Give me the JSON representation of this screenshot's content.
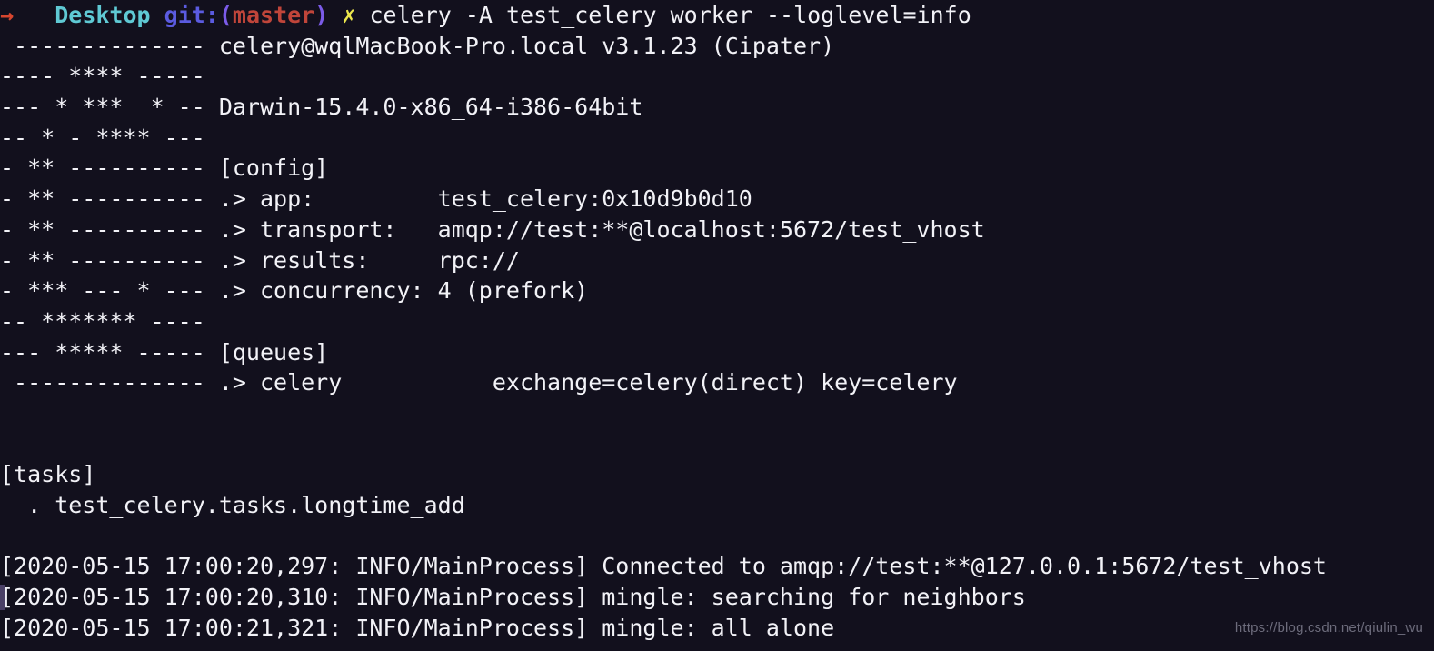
{
  "terminal": {
    "background_color": "#12101d",
    "foreground_color": "#f2f2f7",
    "prompt": {
      "arrow": "→",
      "arrow_color": "#d7462f",
      "directory": "Desktop",
      "directory_color": "#5fc9d4",
      "git_label": "git:",
      "git_label_color": "#5b5be0",
      "paren_open": "(",
      "paren_close": ")",
      "paren_color": "#7b5be8",
      "branch": "master",
      "branch_color": "#c0453a",
      "status_mark": "✗",
      "status_mark_color": "#ece74d",
      "command": "celery -A test_celery worker --loglevel=info"
    },
    "lines": [
      " -------------- celery@wqlMacBook-Pro.local v3.1.23 (Cipater)",
      "---- **** -----",
      "--- * ***  * -- Darwin-15.4.0-x86_64-i386-64bit",
      "-- * - **** ---",
      "- ** ---------- [config]",
      "- ** ---------- .> app:         test_celery:0x10d9b0d10",
      "- ** ---------- .> transport:   amqp://test:**@localhost:5672/test_vhost",
      "- ** ---------- .> results:     rpc://",
      "- *** --- * --- .> concurrency: 4 (prefork)",
      "-- ******* ----",
      "--- ***** ----- [queues]",
      " -------------- .> celery           exchange=celery(direct) key=celery",
      "",
      "",
      "[tasks]",
      "  . test_celery.tasks.longtime_add",
      "",
      "[2020-05-15 17:00:20,297: INFO/MainProcess] Connected to amqp://test:**@127.0.0.1:5672/test_vhost",
      "[2020-05-15 17:00:20,310: INFO/MainProcess] mingle: searching for neighbors",
      "[2020-05-15 17:00:21,321: INFO/MainProcess] mingle: all alone"
    ],
    "cursor_line_index": 18,
    "cursor_color": "#4a4066"
  },
  "watermark": {
    "text": "https://blog.csdn.net/qiulin_wu",
    "color": "#6d6c7c"
  }
}
